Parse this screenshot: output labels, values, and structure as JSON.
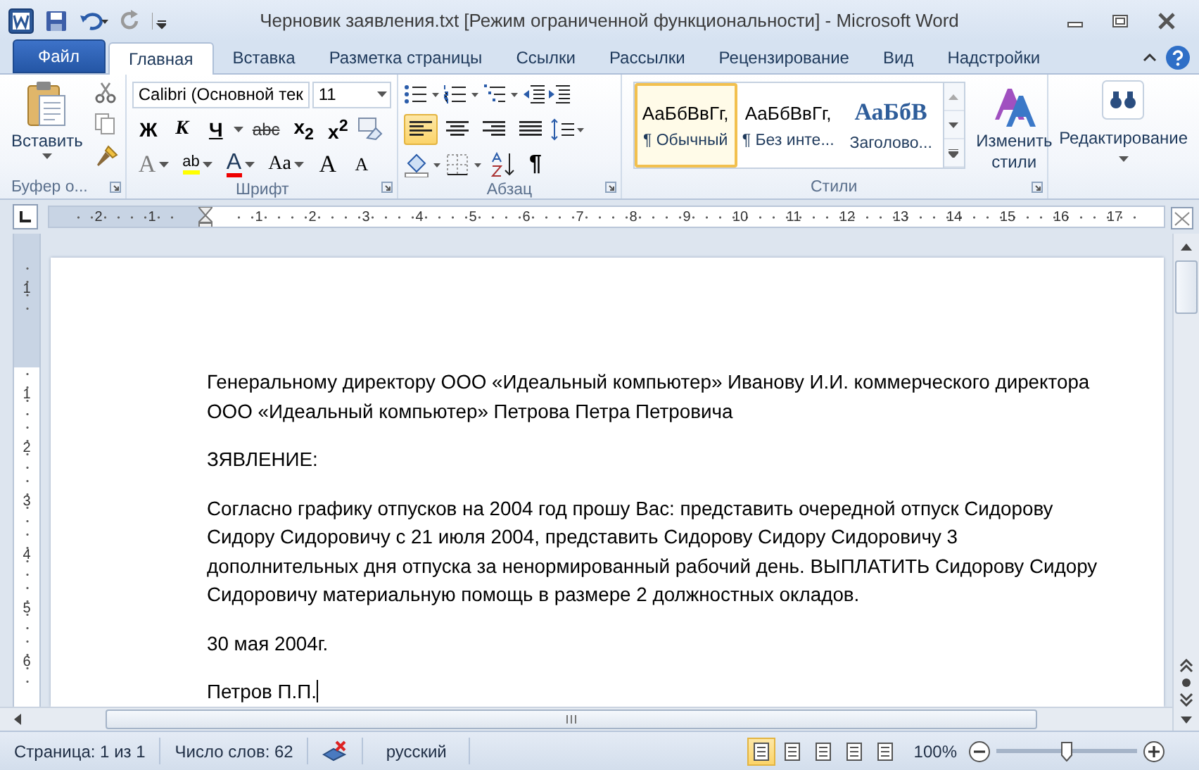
{
  "title_bar": {
    "title": "Черновик заявления.txt [Режим ограниченной функциональности]  -  Microsoft Word"
  },
  "tabs": [
    {
      "label": "Файл",
      "kind": "file",
      "selected": false
    },
    {
      "label": "Главная",
      "kind": "tab",
      "selected": true
    },
    {
      "label": "Вставка",
      "kind": "tab",
      "selected": false
    },
    {
      "label": "Разметка страницы",
      "kind": "tab",
      "selected": false
    },
    {
      "label": "Ссылки",
      "kind": "tab",
      "selected": false
    },
    {
      "label": "Рассылки",
      "kind": "tab",
      "selected": false
    },
    {
      "label": "Рецензирование",
      "kind": "tab",
      "selected": false
    },
    {
      "label": "Вид",
      "kind": "tab",
      "selected": false
    },
    {
      "label": "Надстройки",
      "kind": "tab",
      "selected": false
    }
  ],
  "ribbon": {
    "clipboard": {
      "paste_label": "Вставить",
      "group_label": "Буфер о..."
    },
    "font": {
      "font_name": "Calibri (Основной тек",
      "font_size": "11",
      "group_label": "Шрифт",
      "buttons": [
        {
          "label": "Ж",
          "kind": "bold"
        },
        {
          "label": "К",
          "kind": "italic"
        },
        {
          "label": "Ч",
          "kind": "underline"
        },
        {
          "label": "abc",
          "kind": "strike"
        },
        {
          "label": "x$_{2}$",
          "kind": "script"
        },
        {
          "label": "x$^{2}$",
          "kind": "script"
        }
      ],
      "effects": [
        {
          "label": "A",
          "kind": "effects"
        },
        {
          "label": "ab",
          "kind": "highlight"
        },
        {
          "label": "A",
          "kind": "color"
        },
        {
          "label": "Aa",
          "kind": "case"
        },
        {
          "label": "A",
          "kind": "grow"
        },
        {
          "label": "A",
          "kind": "shrink"
        }
      ]
    },
    "paragraph": {
      "group_label": "Абзац",
      "pilcrow": "¶",
      "alignments": [
        {
          "selected": true
        },
        {
          "selected": false
        },
        {
          "selected": false
        },
        {
          "selected": false
        }
      ]
    },
    "styles": {
      "group_label": "Стили",
      "change_styles": "Изменить стили",
      "items": [
        {
          "preview": "АаБбВвГг,",
          "name": "¶ Обычный",
          "kind": "normal",
          "selected": true
        },
        {
          "preview": "АаБбВвГг,",
          "name": "¶ Без инте...",
          "kind": "normal",
          "selected": false
        },
        {
          "preview": "АаБбВ",
          "name": "Заголово...",
          "kind": "heading",
          "selected": false
        }
      ]
    },
    "editing": {
      "label": "Редактирование"
    }
  },
  "ruler": {
    "left_labels": [
      "2",
      "1"
    ],
    "right_labels": [
      "1",
      "2",
      "3",
      "4",
      "5",
      "6",
      "7",
      "8",
      "9",
      "10",
      "11",
      "12",
      "13",
      "14",
      "15",
      "16",
      "17"
    ]
  },
  "vertical_ruler": {
    "top_labels": [
      "1"
    ],
    "labels": [
      "1",
      "2",
      "3",
      "4",
      "5",
      "6"
    ]
  },
  "document": {
    "paragraphs": [
      "Генеральному директору ООО «Идеальный компьютер» Иванову И.И. коммерческого директора ООО «Идеальный компьютер» Петрова Петра Петровича",
      "ЗЯВЛЕНИЕ:",
      "Согласно графику отпусков на 2004  год прошу Вас: представить очередной отпуск Сидорову Сидору Сидоровичу с 21 июля 2004,  представить Сидорову Сидору Сидоровичу 3 дополнительных дня отпуска за  ненормированный рабочий день. ВЫПЛАТИТЬ Сидорову Сидору Сидоровичу материальную помощь в размере 2 должностных окладов.",
      "30 мая 2004г.",
      "Петров П.П."
    ]
  },
  "status_bar": {
    "page": "Страница: 1 из 1",
    "words": "Число слов: 62",
    "language": "русский",
    "views": [
      {
        "selected": true
      },
      {
        "selected": false
      },
      {
        "selected": false
      },
      {
        "selected": false
      },
      {
        "selected": false
      }
    ],
    "zoom": "100%",
    "zoom_slider": {
      "level": 0.5
    }
  }
}
